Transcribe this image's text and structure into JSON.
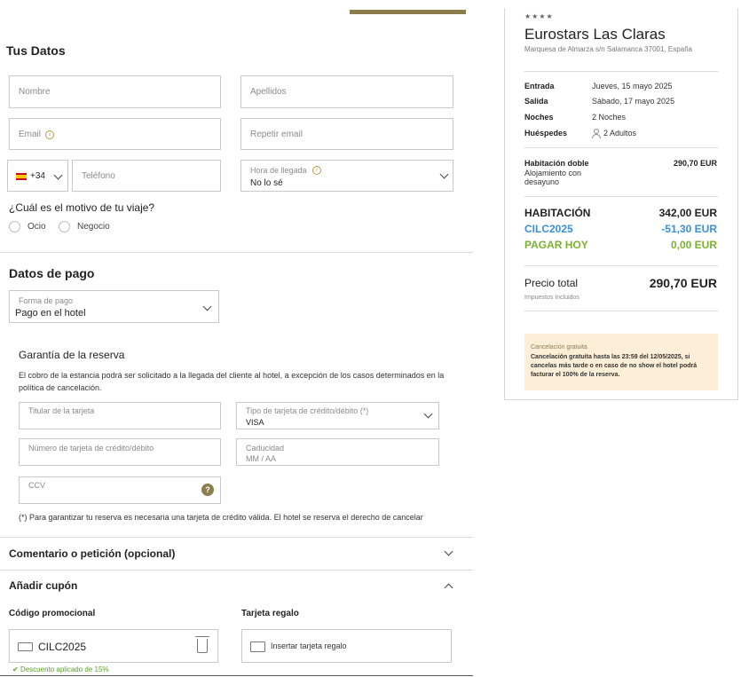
{
  "form": {
    "title": "Tus Datos",
    "nombre_placeholder": "Nombre",
    "apellidos_placeholder": "Apellidos",
    "email_placeholder": "Email",
    "repetir_email_placeholder": "Repetir email",
    "phone_prefix": "+34",
    "telefono_placeholder": "Teléfono",
    "hora_llegada_label": "Hora de llegada",
    "hora_llegada_value": "No lo sé",
    "motivo_question": "¿Cuál es el motivo de tu viaje?",
    "motivo_options": [
      "Ocio",
      "Negocio"
    ]
  },
  "payment": {
    "title": "Datos de pago",
    "forma_pago_label": "Forma de pago",
    "forma_pago_value": "Pago en el hotel",
    "garantia_title": "Garantía de la reserva",
    "garantia_text": "El cobro de la estancia podrá ser solicitado a la llegada del cliente al hotel, a excepción de los casos determinados en la política de cancelación.",
    "titular_placeholder": "Titular de la tarjeta",
    "tipo_tarjeta_label": "Tipo de tarjeta de crédito/débito (*)",
    "tipo_tarjeta_value": "VISA",
    "numero_placeholder": "Número de tarjeta de crédito/débito",
    "caducidad_label": "Caducidad",
    "caducidad_placeholder": "MM / AA",
    "ccv_placeholder": "CCV",
    "note": "(*) Para garantizar tu reserva es necesaria una tarjeta de crédito válida. El hotel se reserva el derecho de cancelar"
  },
  "comment": {
    "title": "Comentario o petición (opcional)"
  },
  "coupon": {
    "title": "Añadir cupón",
    "promo_label": "Código promocional",
    "promo_value": "CILC2025",
    "promo_success": "Descuento aplicado de 15%",
    "gift_label": "Tarjeta regalo",
    "gift_placeholder": "Insertar tarjeta regalo"
  },
  "summary": {
    "stars": "★★★★",
    "hotel_name": "Eurostars Las Claras",
    "address": "Marquesa de Almarza s/n Salamanca 37001, España",
    "rows": [
      {
        "label": "Entrada",
        "value": "Jueves, 15 mayo 2025"
      },
      {
        "label": "Salida",
        "value": "Sábado, 17 mayo 2025"
      },
      {
        "label": "Noches",
        "value": "2 Noches"
      },
      {
        "label": "Huéspedes",
        "value": "2 Adultos"
      }
    ],
    "room_name": "Habitación doble",
    "room_desc": "Alojamiento con desayuno",
    "room_price": "290,70 EUR",
    "habitacion_label": "HABITACIÓN",
    "habitacion_value": "342,00 EUR",
    "discount_label": "CILC2025",
    "discount_value": "-51,30 EUR",
    "pagar_label": "PAGAR HOY",
    "pagar_value": "0,00 EUR",
    "total_label": "Precio total",
    "total_value": "290,70 EUR",
    "taxes": "Impuestos Incluidos",
    "cancel_title": "Cancelación gratuita",
    "cancel_text": "Cancelación gratuita hasta las 23:59 del 12/05/2025, si cancelas más tarde o en caso de no show el hotel podrá facturar el 100% de la reserva."
  },
  "colors": {
    "accent_gold": "#8b7d4e",
    "discount_blue": "#3d8fd1",
    "pay_green": "#7ab32e",
    "cancel_bg": "#fdeed7"
  }
}
